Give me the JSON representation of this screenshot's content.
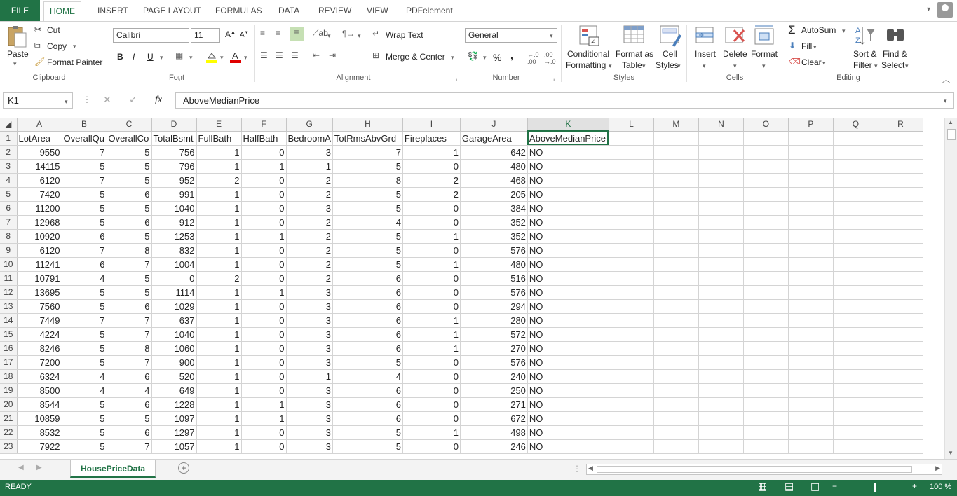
{
  "ribbon_tabs": [
    "FILE",
    "HOME",
    "INSERT",
    "PAGE LAYOUT",
    "FORMULAS",
    "DATA",
    "REVIEW",
    "VIEW",
    "PDFelement"
  ],
  "clipboard": {
    "paste": "Paste",
    "cut": "Cut",
    "copy": "Copy",
    "format_painter": "Format Painter",
    "label": "Clipboard"
  },
  "font": {
    "name": "Calibri",
    "size": "11",
    "label": "Font",
    "bold": "B",
    "italic": "I",
    "underline": "U"
  },
  "alignment": {
    "wrap_text": "Wrap Text",
    "merge_center": "Merge & Center",
    "label": "Alignment"
  },
  "number": {
    "format": "General",
    "label": "Number",
    "percent": "%",
    "comma": ","
  },
  "styles": {
    "conditional": "Conditional",
    "formatting": "Formatting",
    "format_as": "Format as",
    "table": "Table",
    "cell": "Cell",
    "cell_styles": "Styles",
    "label": "Styles"
  },
  "cells": {
    "insert": "Insert",
    "delete": "Delete",
    "format": "Format",
    "label": "Cells"
  },
  "editing": {
    "autosum": "AutoSum",
    "fill": "Fill",
    "clear": "Clear",
    "sort": "Sort &",
    "filter": "Filter",
    "find": "Find &",
    "select": "Select",
    "label": "Editing"
  },
  "formula_bar": {
    "name_box": "K1",
    "fx": "fx",
    "content": "AboveMedianPrice"
  },
  "columns": [
    "A",
    "B",
    "C",
    "D",
    "E",
    "F",
    "G",
    "H",
    "I",
    "J",
    "K",
    "L",
    "M",
    "N",
    "O",
    "P",
    "Q",
    "R"
  ],
  "header_row": [
    "LotArea",
    "OverallQu",
    "OverallCo",
    "TotalBsmt",
    "FullBath",
    "HalfBath",
    "BedroomA",
    "TotRmsAbvGrd",
    "Fireplaces",
    "GarageArea",
    "AboveMedianPrice"
  ],
  "rows": [
    [
      "9550",
      "7",
      "5",
      "756",
      "1",
      "0",
      "3",
      "7",
      "1",
      "642",
      "NO"
    ],
    [
      "14115",
      "5",
      "5",
      "796",
      "1",
      "1",
      "1",
      "5",
      "0",
      "480",
      "NO"
    ],
    [
      "6120",
      "7",
      "5",
      "952",
      "2",
      "0",
      "2",
      "8",
      "2",
      "468",
      "NO"
    ],
    [
      "7420",
      "5",
      "6",
      "991",
      "1",
      "0",
      "2",
      "5",
      "2",
      "205",
      "NO"
    ],
    [
      "11200",
      "5",
      "5",
      "1040",
      "1",
      "0",
      "3",
      "5",
      "0",
      "384",
      "NO"
    ],
    [
      "12968",
      "5",
      "6",
      "912",
      "1",
      "0",
      "2",
      "4",
      "0",
      "352",
      "NO"
    ],
    [
      "10920",
      "6",
      "5",
      "1253",
      "1",
      "1",
      "2",
      "5",
      "1",
      "352",
      "NO"
    ],
    [
      "6120",
      "7",
      "8",
      "832",
      "1",
      "0",
      "2",
      "5",
      "0",
      "576",
      "NO"
    ],
    [
      "11241",
      "6",
      "7",
      "1004",
      "1",
      "0",
      "2",
      "5",
      "1",
      "480",
      "NO"
    ],
    [
      "10791",
      "4",
      "5",
      "0",
      "2",
      "0",
      "2",
      "6",
      "0",
      "516",
      "NO"
    ],
    [
      "13695",
      "5",
      "5",
      "1114",
      "1",
      "1",
      "3",
      "6",
      "0",
      "576",
      "NO"
    ],
    [
      "7560",
      "5",
      "6",
      "1029",
      "1",
      "0",
      "3",
      "6",
      "0",
      "294",
      "NO"
    ],
    [
      "7449",
      "7",
      "7",
      "637",
      "1",
      "0",
      "3",
      "6",
      "1",
      "280",
      "NO"
    ],
    [
      "4224",
      "5",
      "7",
      "1040",
      "1",
      "0",
      "3",
      "6",
      "1",
      "572",
      "NO"
    ],
    [
      "8246",
      "5",
      "8",
      "1060",
      "1",
      "0",
      "3",
      "6",
      "1",
      "270",
      "NO"
    ],
    [
      "7200",
      "5",
      "7",
      "900",
      "1",
      "0",
      "3",
      "5",
      "0",
      "576",
      "NO"
    ],
    [
      "6324",
      "4",
      "6",
      "520",
      "1",
      "0",
      "1",
      "4",
      "0",
      "240",
      "NO"
    ],
    [
      "8500",
      "4",
      "4",
      "649",
      "1",
      "0",
      "3",
      "6",
      "0",
      "250",
      "NO"
    ],
    [
      "8544",
      "5",
      "6",
      "1228",
      "1",
      "1",
      "3",
      "6",
      "0",
      "271",
      "NO"
    ],
    [
      "10859",
      "5",
      "5",
      "1097",
      "1",
      "1",
      "3",
      "6",
      "0",
      "672",
      "NO"
    ],
    [
      "8532",
      "5",
      "6",
      "1297",
      "1",
      "0",
      "3",
      "5",
      "1",
      "498",
      "NO"
    ],
    [
      "7922",
      "5",
      "7",
      "1057",
      "1",
      "0",
      "3",
      "5",
      "0",
      "246",
      "NO"
    ]
  ],
  "sheet_tab": "HousePriceData",
  "status": {
    "ready": "READY",
    "zoom": "100 %"
  },
  "colors": {
    "accent": "#217346"
  }
}
